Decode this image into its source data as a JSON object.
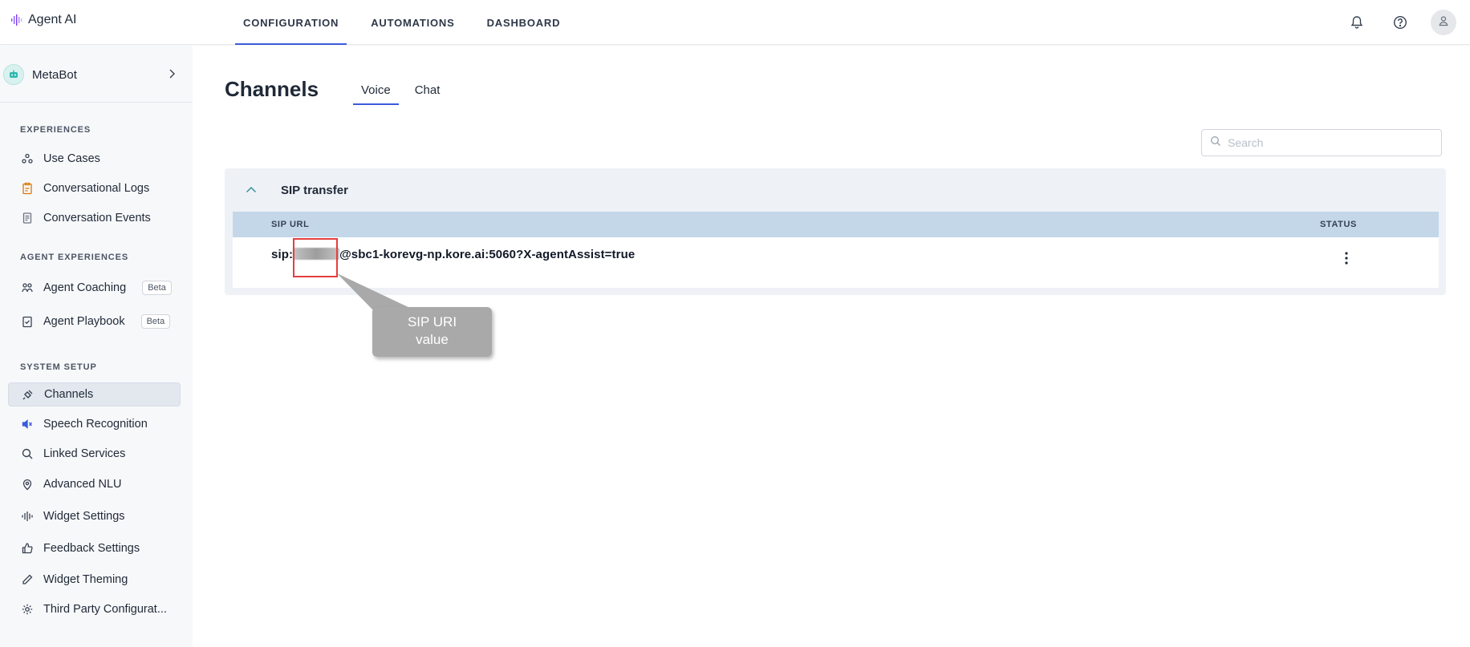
{
  "brand": {
    "name": "Agent AI"
  },
  "nav": {
    "tabs": [
      {
        "label": "CONFIGURATION",
        "active": true
      },
      {
        "label": "AUTOMATIONS",
        "active": false
      },
      {
        "label": "DASHBOARD",
        "active": false
      }
    ]
  },
  "top_icons": [
    "bell-icon",
    "help-icon",
    "user-icon"
  ],
  "sidebar": {
    "bot": {
      "name": "MetaBot"
    },
    "sections": [
      {
        "title": "EXPERIENCES",
        "items": [
          {
            "label": "Use Cases",
            "icon": "use-cases-icon"
          },
          {
            "label": "Conversational Logs",
            "icon": "clipboard-icon"
          },
          {
            "label": "Conversation Events",
            "icon": "document-icon"
          }
        ]
      },
      {
        "title": "AGENT EXPERIENCES",
        "items": [
          {
            "label": "Agent Coaching",
            "icon": "coaching-icon",
            "badge": "Beta"
          },
          {
            "label": "Agent Playbook",
            "icon": "playbook-icon",
            "badge": "Beta"
          }
        ]
      },
      {
        "title": "SYSTEM SETUP",
        "items": [
          {
            "label": "Channels",
            "icon": "plug-icon",
            "active": true
          },
          {
            "label": "Speech Recognition",
            "icon": "speaker-icon"
          },
          {
            "label": "Linked Services",
            "icon": "search-icon"
          },
          {
            "label": "Advanced NLU",
            "icon": "nlu-icon"
          },
          {
            "label": "Widget Settings",
            "icon": "waveform-icon"
          },
          {
            "label": "Feedback Settings",
            "icon": "thumbs-up-icon"
          },
          {
            "label": "Widget Theming",
            "icon": "pen-icon"
          },
          {
            "label": "Third Party Configurat...",
            "icon": "gear-icon"
          }
        ]
      }
    ]
  },
  "main": {
    "title": "Channels",
    "subtabs": [
      {
        "label": "Voice",
        "active": true
      },
      {
        "label": "Chat",
        "active": false
      }
    ],
    "search": {
      "placeholder": "Search",
      "value": ""
    },
    "panel": {
      "title": "SIP transfer",
      "expanded": true,
      "columns": [
        "SIP URL",
        "STATUS"
      ],
      "rows": [
        {
          "url_prefix": "sip:",
          "url_suffix": "@sbc1-korevg-np.kore.ai:5060?X-agentAssist=true"
        }
      ]
    }
  },
  "annotation": {
    "callout_line1": "SIP URI",
    "callout_line2": "value",
    "highlight_color": "#e53e3e"
  },
  "colors": {
    "accent": "#3b5bdb",
    "table_header": "#c3d7e9",
    "sidebar_bg": "#f7f8fa",
    "panel_bg": "#eef1f5"
  }
}
